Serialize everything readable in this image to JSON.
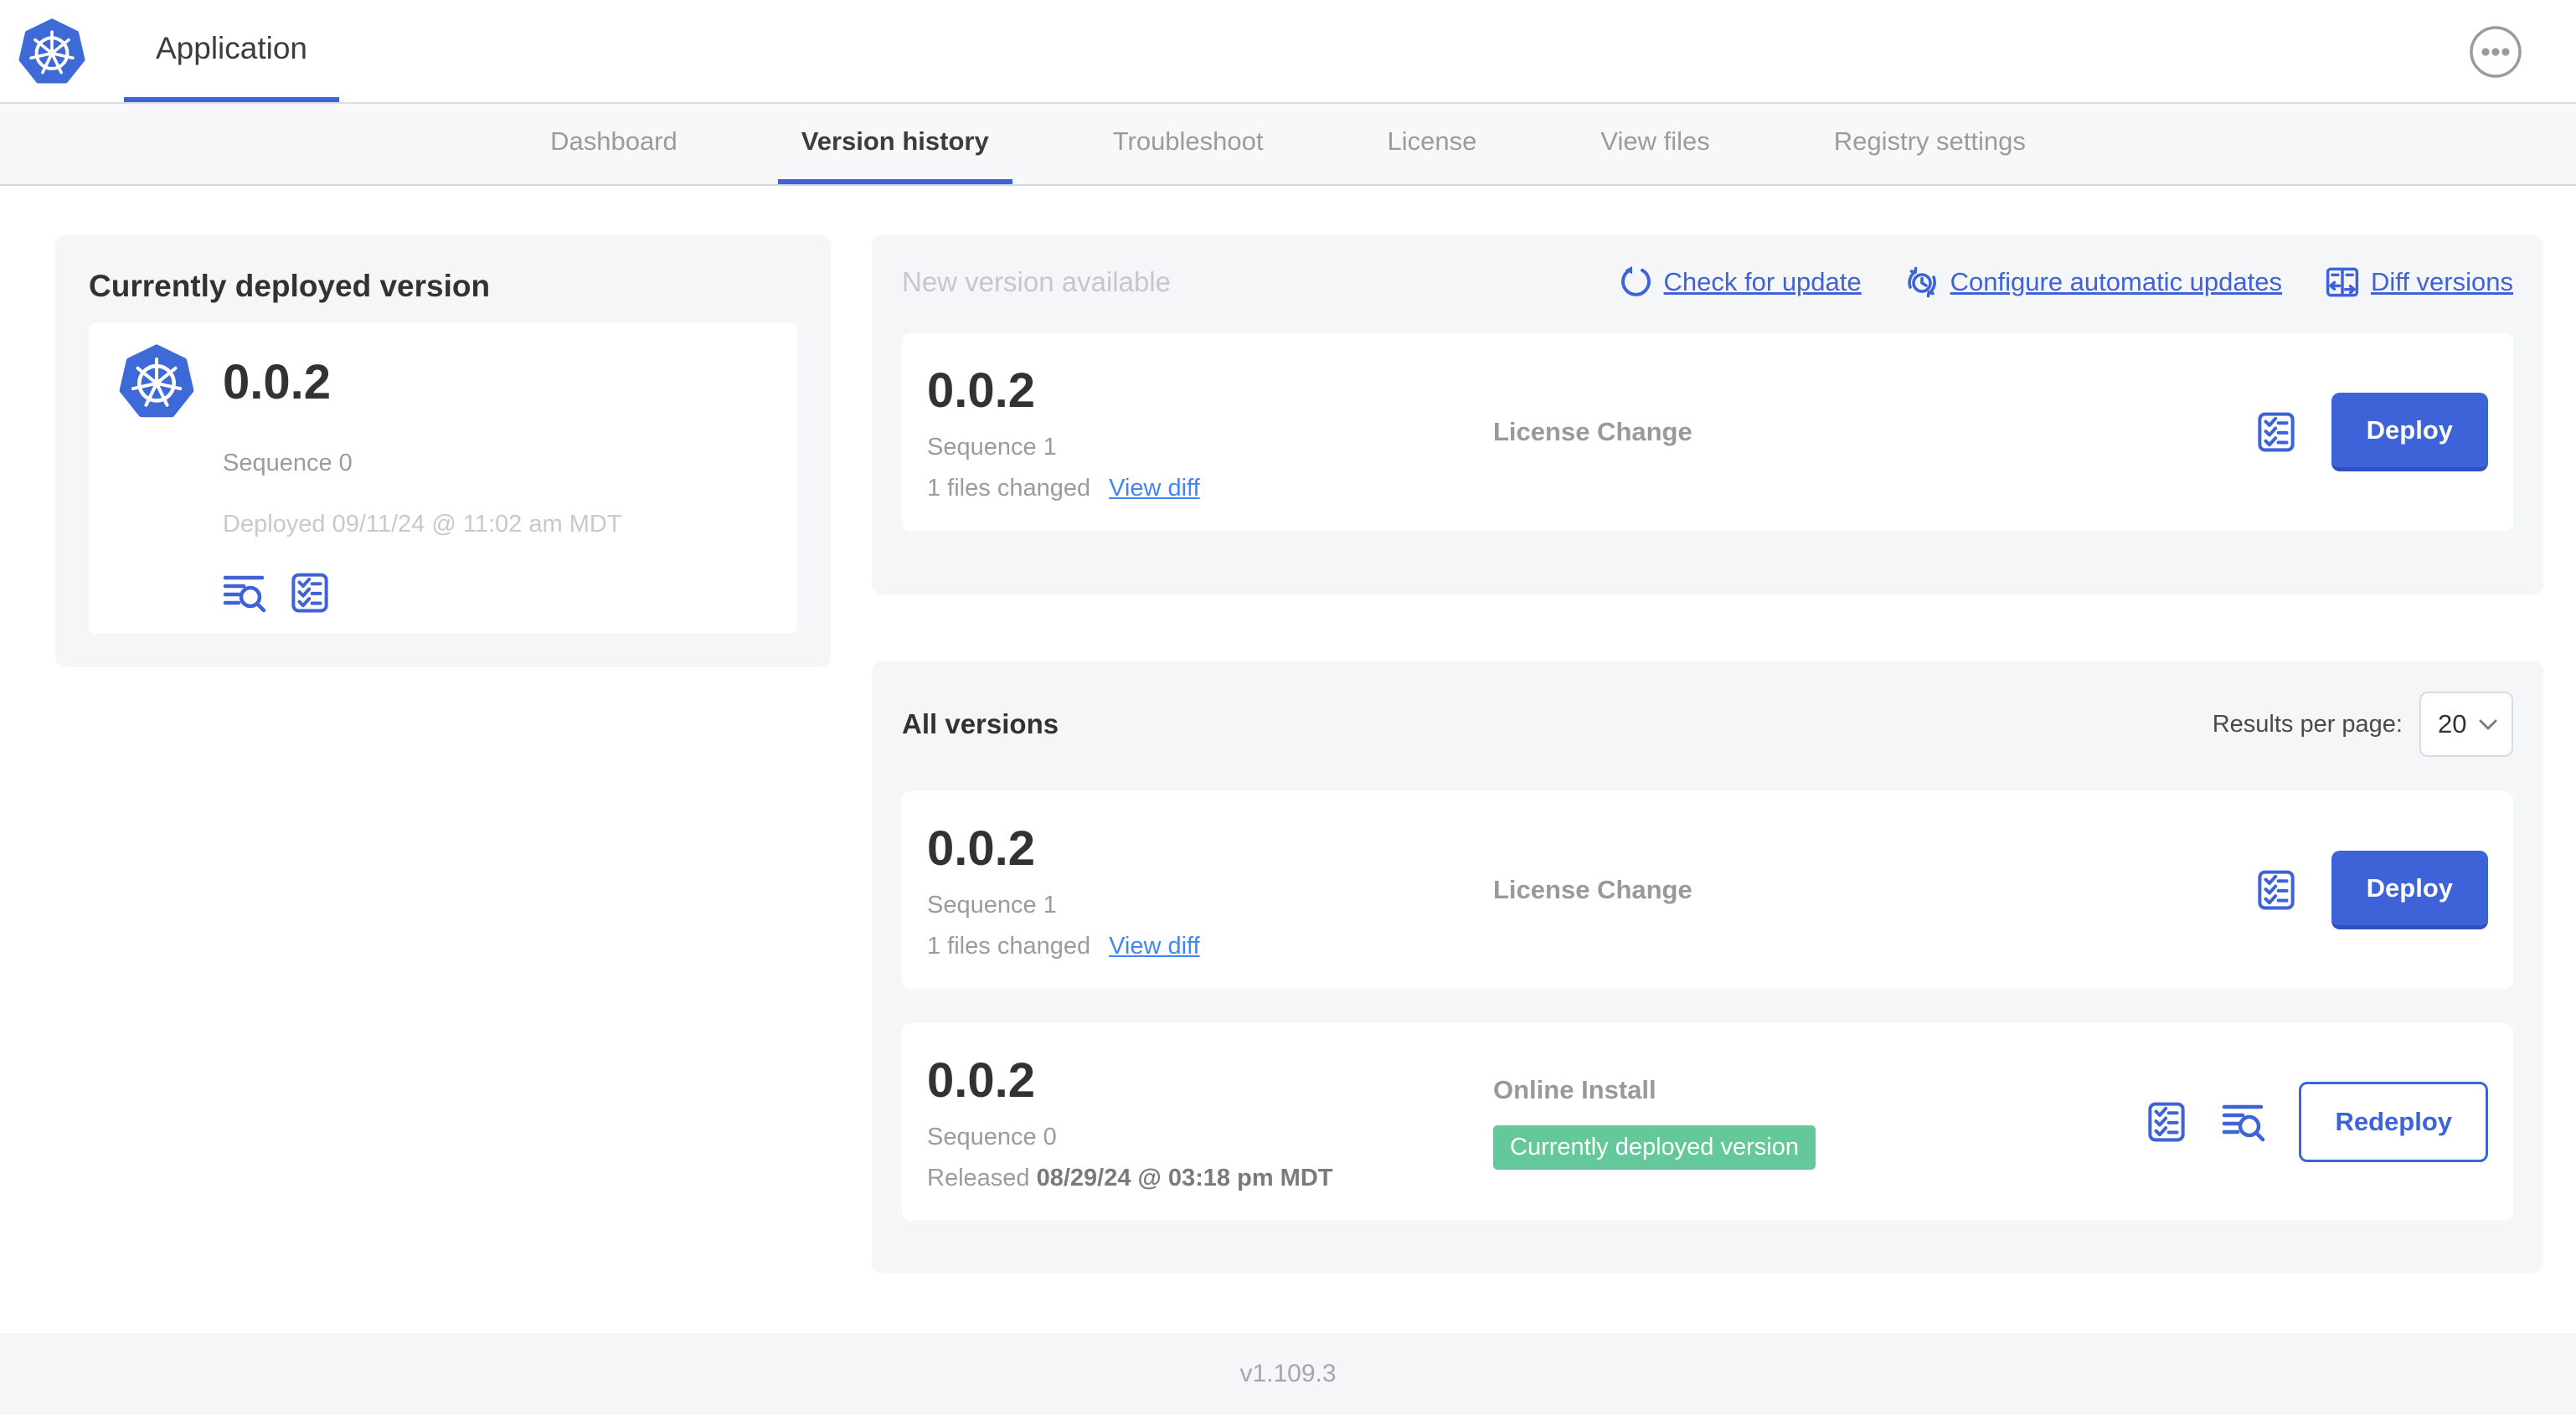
{
  "header": {
    "app_tab_label": "Application"
  },
  "nav": {
    "tabs": [
      {
        "label": "Dashboard"
      },
      {
        "label": "Version history",
        "active": true
      },
      {
        "label": "Troubleshoot"
      },
      {
        "label": "License"
      },
      {
        "label": "View files"
      },
      {
        "label": "Registry settings"
      }
    ]
  },
  "current_version": {
    "title": "Currently deployed version",
    "version": "0.0.2",
    "sequence": "Sequence 0",
    "deployed": "Deployed 09/11/24 @ 11:02 am MDT"
  },
  "new_version": {
    "title": "New version available",
    "check_for_update_label": "Check for update",
    "configure_auto_updates_label": "Configure automatic updates",
    "diff_versions_label": "Diff versions",
    "row": {
      "version": "0.0.2",
      "sequence": "Sequence 1",
      "files_changed": "1 files changed",
      "view_diff_label": "View diff",
      "source": "License Change",
      "action_label": "Deploy"
    }
  },
  "all_versions": {
    "title": "All versions",
    "results_per_page_label": "Results per page:",
    "results_per_page_value": "20",
    "rows": [
      {
        "version": "0.0.2",
        "sequence": "Sequence 1",
        "files_changed": "1 files changed",
        "view_diff_label": "View diff",
        "source": "License Change",
        "action_label": "Deploy"
      },
      {
        "version": "0.0.2",
        "sequence": "Sequence 0",
        "released_prefix": "Released",
        "released_date": "08/29/24 @ 03:18 pm MDT",
        "source": "Online Install",
        "badge_label": "Currently deployed version",
        "action_label": "Redeploy"
      }
    ]
  },
  "footer": {
    "app_version": "v1.109.3"
  },
  "colors": {
    "primary_blue": "#3E63D8",
    "link_blue": "#4285F4",
    "badge_green": "#65C89A",
    "k8s_logo_blue": "#3E6AD8",
    "card_gray": "#F5F6F8"
  }
}
